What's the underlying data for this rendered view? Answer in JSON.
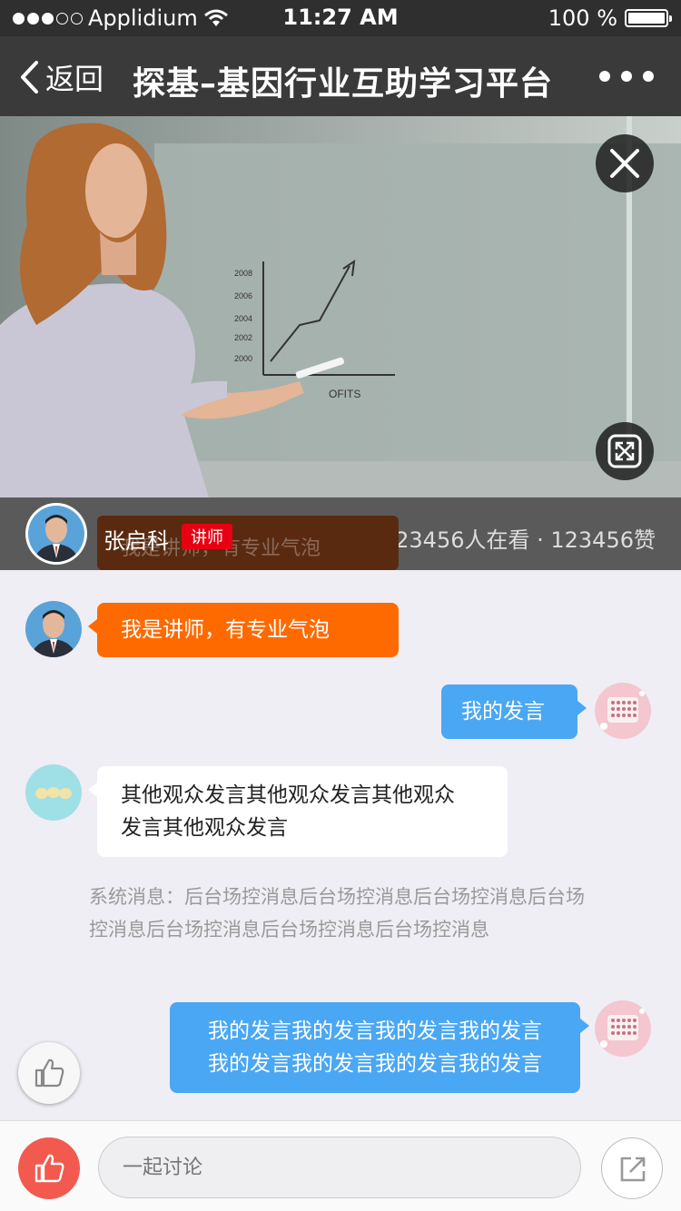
{
  "status_bar": {
    "carrier": "Applidium",
    "time": "11:27 AM",
    "battery": "100 %",
    "signal_bars_filled": 3,
    "signal_bars_total": 5
  },
  "nav": {
    "back_label": "返回",
    "title": "探基–基因行业互助学习平台",
    "more_icon": "more-dots-icon"
  },
  "video": {
    "close_icon": "close-icon",
    "fullscreen_icon": "fullscreen-icon",
    "board_years": [
      "2008",
      "2006",
      "2004",
      "2002",
      "2000"
    ],
    "board_label": "OFITS"
  },
  "live_info": {
    "host_name": "张启科",
    "badge": "讲师",
    "ghost_text": "我是讲师，有专业气泡",
    "stats": "123456人在看 · 123456赞"
  },
  "messages": [
    {
      "role": "teacher",
      "lines": [
        "我是讲师，有专业气泡"
      ]
    },
    {
      "role": "me",
      "lines": [
        "我的发言"
      ]
    },
    {
      "role": "other",
      "lines": [
        "其他观众发言其他观众发言其他观众",
        "发言其他观众发言"
      ]
    },
    {
      "role": "system",
      "text": "系统消息：后台场控消息后台场控消息后台场控消息后台场控消息后台场控消息后台场控消息后台场控消息"
    },
    {
      "role": "me",
      "lines": [
        "我的发言我的发言我的发言我的发言",
        "我的发言我的发言我的发言我的发言"
      ]
    }
  ],
  "bottom_bar": {
    "input_placeholder": "一起讨论",
    "like_icon": "thumbs-up-icon",
    "share_icon": "share-icon"
  },
  "colors": {
    "teacher_bubble": "#ff6a00",
    "my_bubble": "#4aa7f4",
    "badge": "#e60012",
    "like_button": "#f25a4f",
    "chat_background": "#efeef4"
  }
}
